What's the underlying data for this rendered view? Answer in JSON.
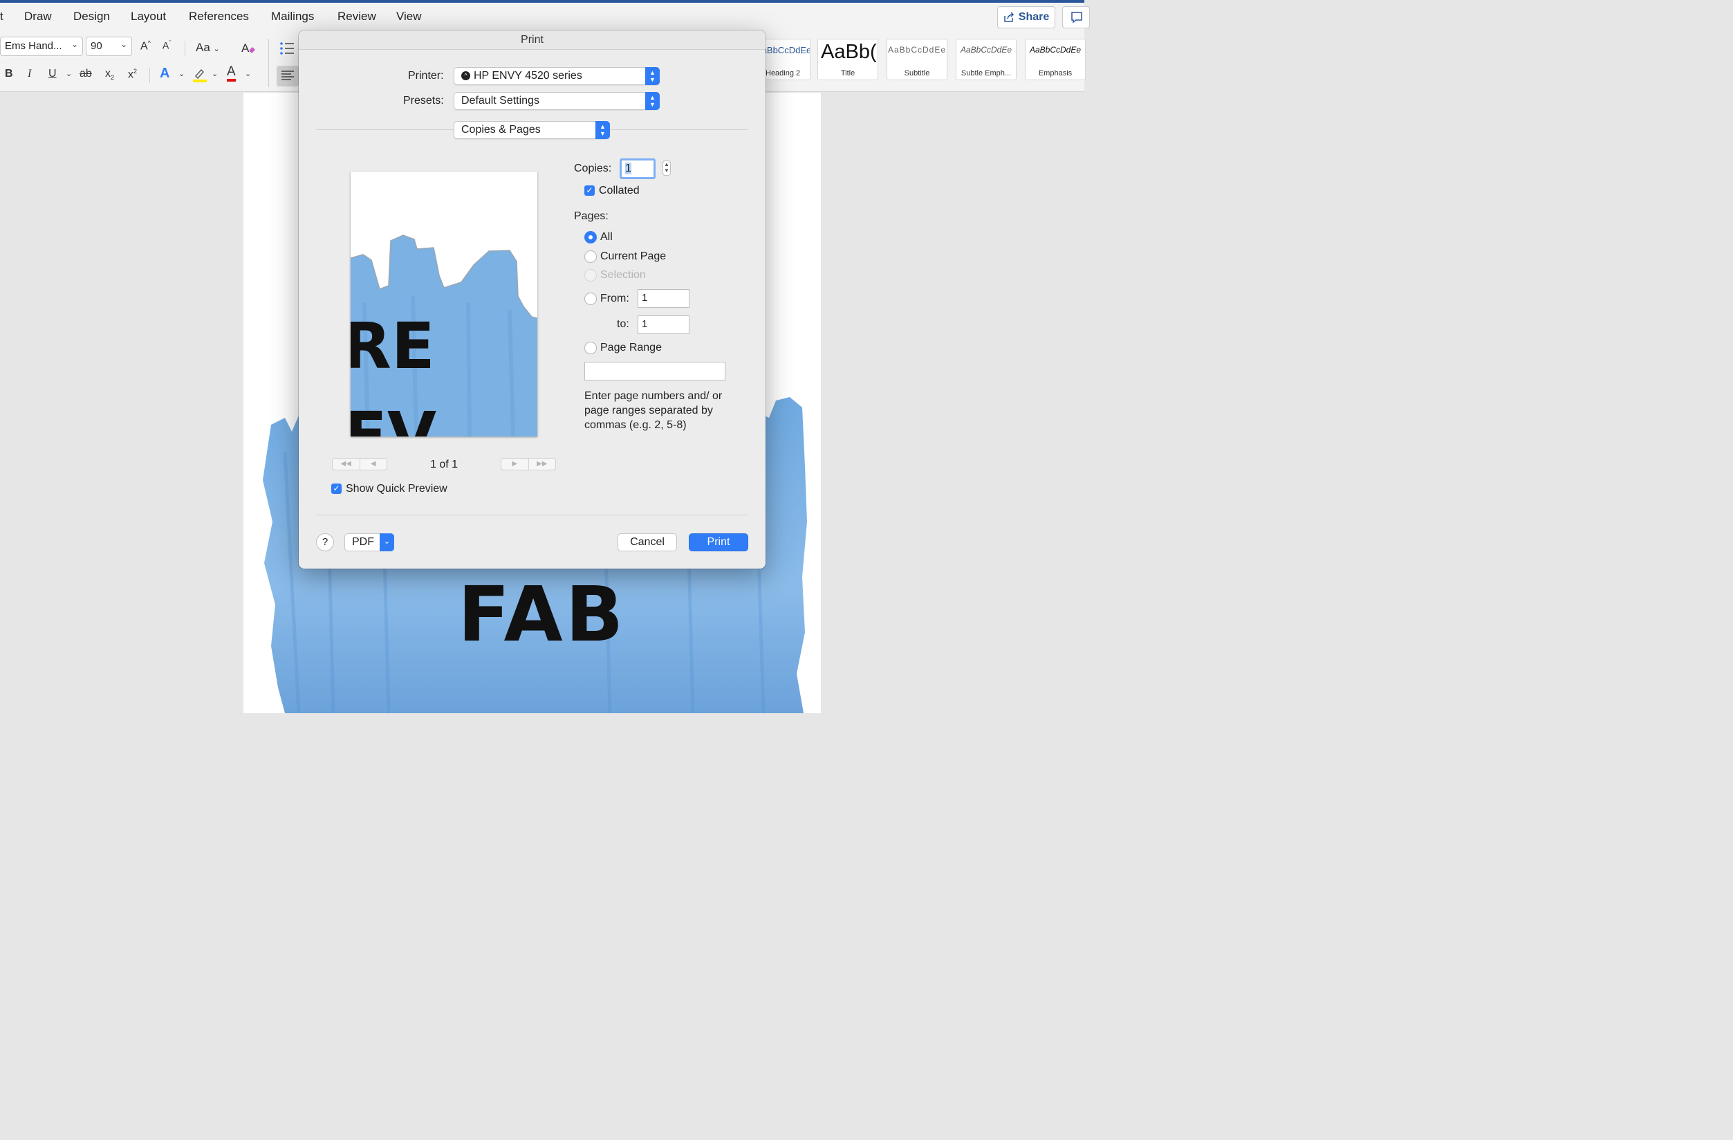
{
  "menu": {
    "items": [
      "t",
      "Draw",
      "Design",
      "Layout",
      "References",
      "Mailings",
      "Review",
      "View"
    ],
    "share": "Share"
  },
  "font": {
    "name": "Ems Hand...",
    "size": "90"
  },
  "toolbar": {
    "grow": "A",
    "shrink": "A",
    "change_case": "Aa",
    "bold": "B",
    "italic": "I",
    "underline": "U",
    "strike": "ab",
    "subscript": "x",
    "superscript": "x",
    "text_effects": "A",
    "font_color": "A",
    "colors": {
      "highlight": "#ffeb00",
      "font_color": "#e01010",
      "effects": "#2f7cf6"
    }
  },
  "styles": [
    {
      "sample": "AaBbCcDdEe",
      "name": "Heading 2"
    },
    {
      "sample": "AaBb(",
      "name": "Title"
    },
    {
      "sample": "AaBbCcDdEe",
      "name": "Subtitle"
    },
    {
      "sample": "AaBbCcDdEe",
      "name": "Subtle Emph..."
    },
    {
      "sample": "AaBbCcDdEe",
      "name": "Emphasis"
    }
  ],
  "document": {
    "word": "FAB",
    "preview_text_top": "RE",
    "preview_text_bottom": "EV",
    "wash_color": "#6aa7e0"
  },
  "dialog": {
    "title": "Print",
    "printer_label": "Printer:",
    "printer_value": "HP ENVY 4520 series",
    "presets_label": "Presets:",
    "presets_value": "Default Settings",
    "section_value": "Copies & Pages",
    "copies_label": "Copies:",
    "copies_value": "1",
    "collated": "Collated",
    "pages_label": "Pages:",
    "page_options": [
      "All",
      "Current Page",
      "Selection"
    ],
    "from_label": "From:",
    "from_value": "1",
    "to_label": "to:",
    "to_value": "1",
    "page_range_label": "Page Range",
    "help_text": "Enter page numbers and/ or page ranges separated by commas (e.g. 2, 5-8)",
    "page_indicator": "1 of 1",
    "show_preview": "Show Quick Preview",
    "help_button": "?",
    "pdf_button": "PDF",
    "cancel_button": "Cancel",
    "print_button": "Print",
    "accent": "#2f7cf6"
  }
}
